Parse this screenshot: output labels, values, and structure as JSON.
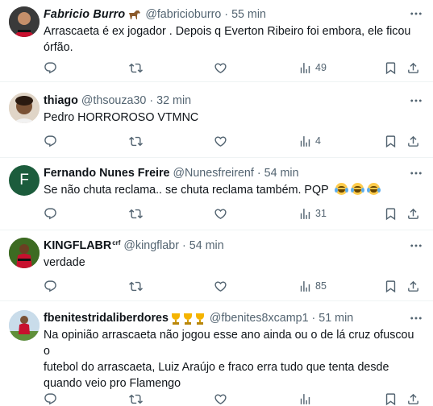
{
  "colors": {
    "text": "#0f1419",
    "secondary": "#536471",
    "divider": "#eff3f4",
    "avatar_f": "#1c5c3c"
  },
  "icons": {
    "reply": "reply-icon",
    "retweet": "retweet-icon",
    "like": "heart-icon",
    "views": "views-icon",
    "bookmark": "bookmark-icon",
    "share": "share-icon",
    "more": "more-icon"
  },
  "tweets": [
    {
      "name": "Fabricio Burro",
      "handle": "@fabricioburro",
      "dot": "·",
      "time": "55 min",
      "text_lines": [
        "Arrascaeta é ex jogador . Depois q Everton Ribeiro foi embora, ele ficou",
        "órfão."
      ],
      "views": "49"
    },
    {
      "name": "thiago",
      "handle": "@thsouza30",
      "dot": "·",
      "time": "32 min",
      "text_lines": [
        "Pedro HORROROSO VTMNC"
      ],
      "views": "4"
    },
    {
      "name": "Fernando Nunes Freire",
      "handle": "@Nunesfreirenf",
      "dot": "·",
      "time": "54 min",
      "avatar_letter": "F",
      "text_lines": [
        "Se não chuta reclama.. se chuta reclama também. PQP"
      ],
      "views": "31"
    },
    {
      "name": "KINGFLABR",
      "name_suffix": "crf",
      "handle": "@kingflabr",
      "dot": "·",
      "time": "54 min",
      "text_lines": [
        "verdade"
      ],
      "views": "85"
    },
    {
      "name": "fbenitestridaliberdores",
      "handle": "@fbenites8xcamp1",
      "dot": "·",
      "time": "51 min",
      "text_lines": [
        "Na opinião arrascaeta não jogou esse ano ainda ou o de lá cruz ofuscou o",
        "futebol do arrascaeta, Luiz Araújo e fraco erra tudo que tenta desde",
        "quando veio pro Flamengo"
      ]
    }
  ]
}
